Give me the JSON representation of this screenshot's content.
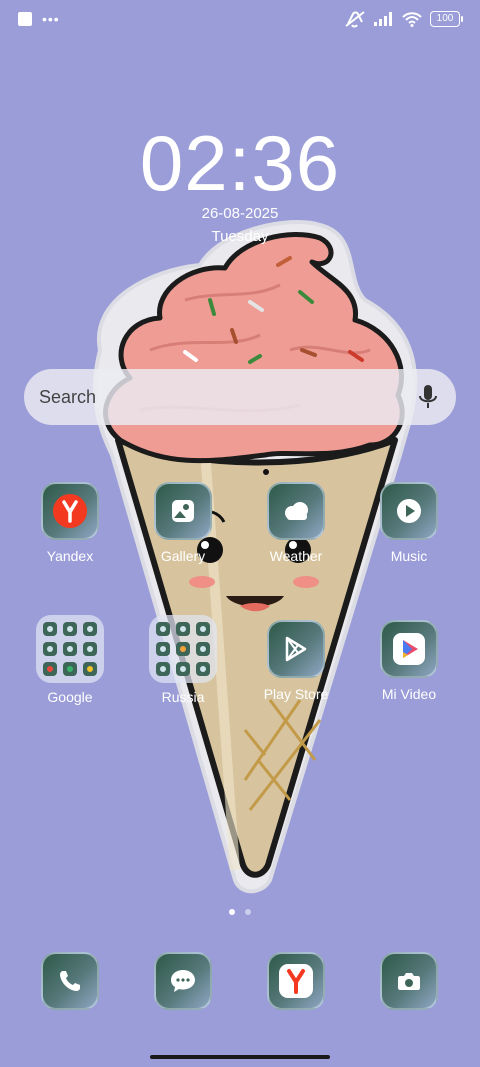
{
  "status_bar": {
    "battery": "100"
  },
  "lockscreen": {
    "time": "02:36",
    "date": "26-08-2025",
    "weekday": "Tuesday"
  },
  "search": {
    "placeholder": "Search"
  },
  "apps": [
    {
      "label": "Yandex",
      "icon": "yandex-icon"
    },
    {
      "label": "Gallery",
      "icon": "gallery-icon"
    },
    {
      "label": "Weather",
      "icon": "weather-icon"
    },
    {
      "label": "Music",
      "icon": "music-icon"
    },
    {
      "label": "Google",
      "icon": "folder-icon"
    },
    {
      "label": "Russia",
      "icon": "folder-icon"
    },
    {
      "label": "Play Store",
      "icon": "play-store-icon"
    },
    {
      "label": "Mi Video",
      "icon": "mi-video-icon"
    }
  ],
  "dock": [
    {
      "icon": "phone-icon"
    },
    {
      "icon": "messages-icon"
    },
    {
      "icon": "yandex-browser-icon"
    },
    {
      "icon": "camera-icon"
    }
  ],
  "pages": {
    "count": 2,
    "current": 1
  },
  "colors": {
    "background": "#9b9dd8",
    "yandex_red": "#f33a20"
  }
}
